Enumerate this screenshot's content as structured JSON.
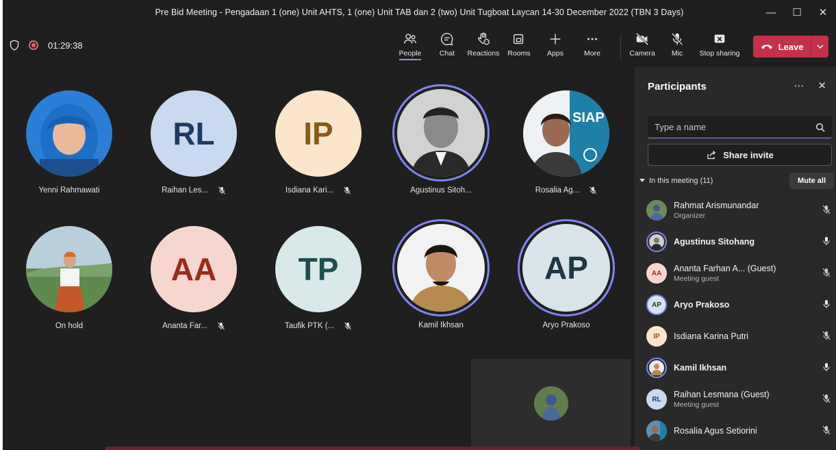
{
  "window": {
    "title": "Pre Bid Meeting - Pengadaan 1 (one) Unit AHTS, 1 (one) Unit TAB dan 2 (two) Unit Tugboat Laycan 14-30 December 2022 (TBN 3 Days)"
  },
  "toolbar": {
    "timer": "01:29:38",
    "buttons": {
      "people": "People",
      "chat": "Chat",
      "reactions": "Reactions",
      "rooms": "Rooms",
      "apps": "Apps",
      "more": "More",
      "camera": "Camera",
      "mic": "Mic",
      "stop_sharing": "Stop sharing"
    },
    "leave": "Leave"
  },
  "tiles": [
    {
      "name": "Yenni Rahmawati",
      "initials": "",
      "bg": "#2b7fd6",
      "photo": true
    },
    {
      "name": "Raihan Les...",
      "initials": "RL",
      "bg": "#c9d9ef",
      "fg": "#1f3b64"
    },
    {
      "name": "Isdiana Kari...",
      "initials": "IP",
      "bg": "#fbe6cc",
      "fg": "#8a5a14"
    },
    {
      "name": "Agustinus Sitoh...",
      "initials": "",
      "bg": "#d8d8d8",
      "photo": true
    },
    {
      "name": "Rosalia Ag...",
      "initials": "",
      "bg": "#e8eef0",
      "photo": true
    },
    {
      "name": "On hold",
      "initials": "",
      "bg": "#8fb3c8",
      "photo": true
    },
    {
      "name": "Ananta Far...",
      "initials": "AA",
      "bg": "#f7d6d0",
      "fg": "#9a2b1a"
    },
    {
      "name": "Taufik PTK (...",
      "initials": "TP",
      "bg": "#d9e8e8",
      "fg": "#1e4f52"
    },
    {
      "name": "Kamil Ikhsan",
      "initials": "",
      "bg": "#f2f2f2",
      "photo": true
    },
    {
      "name": "Aryo Prakoso",
      "initials": "AP",
      "bg": "#d9e4ea",
      "fg": "#1f3745"
    }
  ],
  "participants": {
    "title": "Participants",
    "search_placeholder": "Type a name",
    "share_invite": "Share invite",
    "section": "In this meeting (11)",
    "mute_all": "Mute all",
    "list": [
      {
        "name": "Rahmat Arismunandar",
        "sub": "Organizer",
        "initials": "",
        "bg": "#6c8b5d",
        "bold": false,
        "mic": "off"
      },
      {
        "name": "Agustinus Sitohang",
        "sub": "",
        "initials": "",
        "bg": "#cfcfcf",
        "bold": true,
        "mic": "on"
      },
      {
        "name": "Ananta Farhan A... (Guest)",
        "sub": "Meeting guest",
        "initials": "AA",
        "bg": "#f7d6d0",
        "fg": "#9a2b1a",
        "bold": false,
        "mic": "off"
      },
      {
        "name": "Aryo Prakoso",
        "sub": "",
        "initials": "AP",
        "bg": "#d9e4ea",
        "fg": "#1f3745",
        "bold": true,
        "mic": "on"
      },
      {
        "name": "Isdiana Karina Putri",
        "sub": "",
        "initials": "IP",
        "bg": "#fbe6cc",
        "fg": "#8a5a14",
        "bold": false,
        "mic": "off"
      },
      {
        "name": "Kamil Ikhsan",
        "sub": "",
        "initials": "",
        "bg": "#efefef",
        "bold": true,
        "mic": "on"
      },
      {
        "name": "Raihan Lesmana (Guest)",
        "sub": "Meeting guest",
        "initials": "RL",
        "bg": "#c9d9ef",
        "fg": "#1f3b64",
        "bold": false,
        "mic": "off"
      },
      {
        "name": "Rosalia Agus Setiorini",
        "sub": "",
        "initials": "",
        "bg": "#5e8fb0",
        "bold": false,
        "mic": "off"
      }
    ]
  }
}
